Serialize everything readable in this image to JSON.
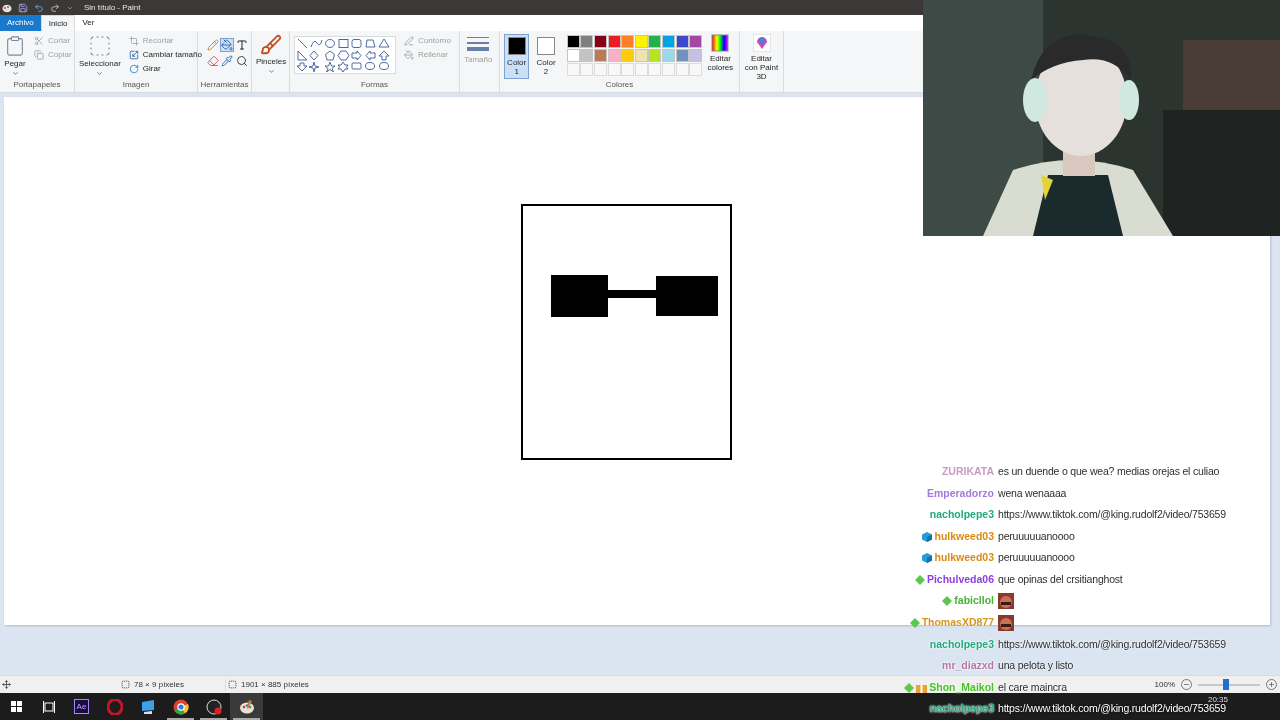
{
  "title_bar": {
    "title": "Sin título - Paint"
  },
  "tabs": [
    {
      "label": "Archivo",
      "kind": "file",
      "selected": false
    },
    {
      "label": "Inicio",
      "kind": "tab",
      "selected": true
    },
    {
      "label": "Ver",
      "kind": "tab",
      "selected": false
    }
  ],
  "ribbon": {
    "clipboard": {
      "group": "Portapapeles",
      "paste": "Pegar",
      "cut": {
        "label": "Cortar",
        "disabled": true
      },
      "copy": {
        "label": "Copiar",
        "disabled": true
      }
    },
    "image": {
      "group": "Imagen",
      "select": "Seleccionar",
      "crop": {
        "label": "Recortar",
        "disabled": true
      },
      "resize": {
        "label": "Cambiar tamaño",
        "disabled": false
      },
      "rotate": {
        "label": "Girar",
        "disabled": false
      }
    },
    "tools": {
      "group": "Herramientas",
      "items": [
        {
          "kind": "pencil",
          "selected": false
        },
        {
          "kind": "fill",
          "selected": true
        },
        {
          "kind": "text",
          "selected": false
        },
        {
          "kind": "eraser",
          "selected": false
        },
        {
          "kind": "picker",
          "selected": false
        },
        {
          "kind": "magnifier",
          "selected": false
        }
      ]
    },
    "brushes": "Pinceles",
    "shapes": {
      "group": "Formas",
      "outline": {
        "label": "Contorno",
        "disabled": true
      },
      "fill": {
        "label": "Rellenar",
        "disabled": true
      }
    },
    "size": {
      "label": "Tamaño",
      "disabled": true
    },
    "colors": {
      "group": "Colores",
      "color1": {
        "label": "Color 1",
        "color": "#000000",
        "selected": true
      },
      "color2": {
        "label": "Color 2",
        "color": "#ffffff",
        "selected": false
      },
      "palette": [
        {
          "color": "#000000"
        },
        {
          "color": "#7f7f7f"
        },
        {
          "color": "#880015"
        },
        {
          "color": "#ed1c24"
        },
        {
          "color": "#ff7f27"
        },
        {
          "color": "#fff200"
        },
        {
          "color": "#22b14c"
        },
        {
          "color": "#00a2e8"
        },
        {
          "color": "#3f48cc"
        },
        {
          "color": "#a349a4"
        },
        {
          "color": "#ffffff"
        },
        {
          "color": "#c3c3c3"
        },
        {
          "color": "#b97a57"
        },
        {
          "color": "#ffaec9"
        },
        {
          "color": "#ffc90e"
        },
        {
          "color": "#efe4b0"
        },
        {
          "color": "#b5e61d"
        },
        {
          "color": "#99d9ea"
        },
        {
          "color": "#7092be"
        },
        {
          "color": "#c8bfe7"
        }
      ],
      "edit": "Editar colores"
    },
    "paint3d": "Editar con Paint 3D"
  },
  "status_bar": {
    "selection_size": "78 × 9 píxeles",
    "canvas_size": "1901 × 885 píxeles",
    "zoom": "100%",
    "zoom_slider": {
      "level": 0.45
    }
  },
  "chat": [
    {
      "user": "ZURIKATA",
      "color": "#c99ac4",
      "text": "es un duende o que wea? medias orejas el culiao"
    },
    {
      "user": "Emperadorzo",
      "color": "#a57ad8",
      "text": "wena wenaaaa"
    },
    {
      "user": "nacholpepe3",
      "color": "#1faa7c",
      "text": "https://www.tiktok.com/@king.rudolf2/video/753659"
    },
    {
      "user": "hulkweed03",
      "color": "#d98c12",
      "badges": [
        {
          "kind": "cube"
        }
      ],
      "text": "peruuuuuanoooo"
    },
    {
      "user": "hulkweed03",
      "color": "#d98c12",
      "badges": [
        {
          "kind": "cube"
        }
      ],
      "text": "peruuuuuanoooo"
    },
    {
      "user": "Pichulveda06",
      "color": "#8c3fe0",
      "badges": [
        {
          "kind": "diamond"
        }
      ],
      "text": "que opinas del crsitianghost"
    },
    {
      "user": "fabicllol",
      "color": "#46b236",
      "badges": [
        {
          "kind": "diamond"
        }
      ],
      "emote": true
    },
    {
      "user": "ThomasXD877",
      "color": "#d6961c",
      "badges": [
        {
          "kind": "diamond"
        }
      ],
      "emote": true
    },
    {
      "user": "nacholpepe3",
      "color": "#1faa7c",
      "text": "https://www.tiktok.com/@king.rudolf2/video/753659"
    },
    {
      "user": "mr_diazxd",
      "color": "#b775a6",
      "text": "una pelota y listo"
    },
    {
      "user": "Shon_Maikol",
      "color": "#44c224",
      "badges": [
        {
          "kind": "diamond"
        },
        {
          "kind": "gift"
        }
      ],
      "text": "el care maincra"
    },
    {
      "user": "nacholpepe3",
      "color": "#1faa7c",
      "text": "https://www.tiktok.com/@king.rudolf2/video/753659"
    }
  ],
  "taskbar": {
    "apps": [
      {
        "kind": "taskview",
        "running": false,
        "active": false
      },
      {
        "kind": "ae",
        "label": "Ae",
        "running": false,
        "active": false
      },
      {
        "kind": "opera",
        "running": false,
        "active": false
      },
      {
        "kind": "monitor",
        "running": false,
        "active": false
      },
      {
        "kind": "chrome",
        "running": true,
        "active": false
      },
      {
        "kind": "obs",
        "running": true,
        "active": false
      },
      {
        "kind": "paint",
        "running": true,
        "active": true
      }
    ],
    "clock": "20:35"
  }
}
